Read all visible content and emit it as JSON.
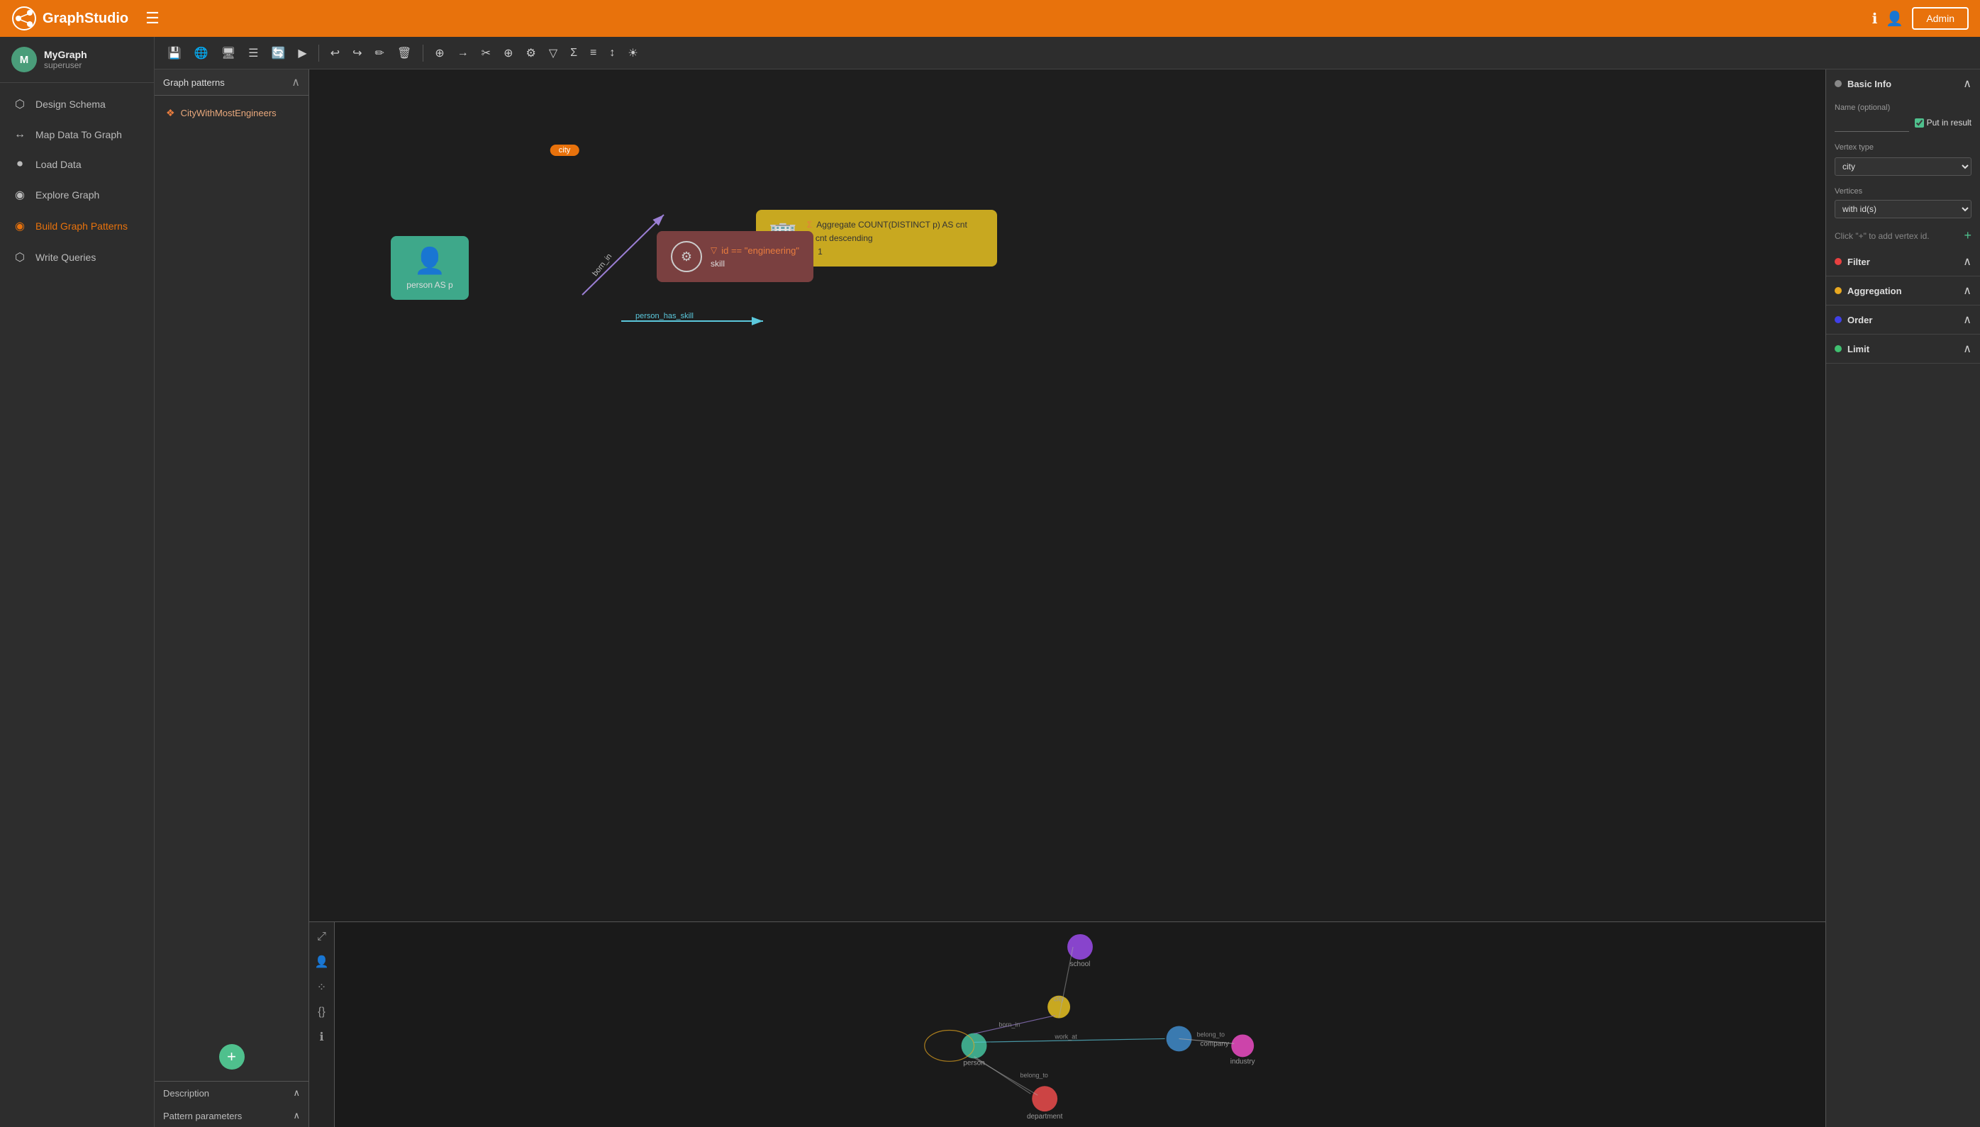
{
  "app": {
    "name": "GraphStudio",
    "hamburger": "☰"
  },
  "nav": {
    "admin_btn": "Admin",
    "info_icon": "ℹ",
    "user_icon": "👤"
  },
  "sidebar": {
    "user": {
      "initial": "M",
      "name": "MyGraph",
      "role": "superuser"
    },
    "items": [
      {
        "id": "design-schema",
        "label": "Design Schema",
        "icon": "⬡"
      },
      {
        "id": "map-data",
        "label": "Map Data To Graph",
        "icon": "↔"
      },
      {
        "id": "load-data",
        "label": "Load Data",
        "icon": "⏺"
      },
      {
        "id": "explore-graph",
        "label": "Explore Graph",
        "icon": "◉"
      },
      {
        "id": "build-patterns",
        "label": "Build Graph Patterns",
        "icon": "◉",
        "active": true
      },
      {
        "id": "write-queries",
        "label": "Write Queries",
        "icon": "⬡"
      }
    ]
  },
  "toolbar": {
    "buttons": [
      "💾",
      "🌐",
      "🖥",
      "☰",
      "🔄",
      "▶",
      "↩",
      "↪",
      "✏",
      "🗑",
      "⊕",
      "→",
      "✂",
      "⊕",
      "⚙",
      "▽",
      "Σ",
      "≡",
      "↕",
      "☀"
    ],
    "label": "Toolbar"
  },
  "pattern_panel": {
    "title": "Graph patterns",
    "item": "CityWithMostEngineers",
    "description_label": "Description",
    "parameters_label": "Pattern parameters"
  },
  "working_panel": {
    "label": "Working Panel",
    "city_node": {
      "label": "city",
      "lines": [
        "Aggregate COUNT(DISTINCT p) AS cnt",
        "cnt descending",
        "1"
      ]
    },
    "person_node": {
      "label": "person AS p"
    },
    "skill_node": {
      "label": "skill",
      "filter": "id == \"engineering\""
    },
    "edge_born_in": "born_in",
    "edge_person_skill": "person_has_skill"
  },
  "config_panel": {
    "title": "Basic Info",
    "label_title": "Config Panel",
    "name_label": "Name (optional)",
    "name_placeholder": "",
    "put_in_result": "Put in result",
    "vertex_type_label": "Vertex type",
    "vertex_type_value": "city",
    "vertices_label": "Vertices",
    "vertices_option": "with id(s)",
    "click_add_label": "Click \"+\" to add vertex id.",
    "sections": [
      {
        "id": "filter",
        "label": "Filter",
        "color": "#e84040"
      },
      {
        "id": "aggregation",
        "label": "Aggregation",
        "color": "#e8a820"
      },
      {
        "id": "order",
        "label": "Order",
        "color": "#4040e8"
      },
      {
        "id": "limit",
        "label": "Limit",
        "color": "#40c070"
      }
    ]
  },
  "console": {
    "label": "Console",
    "tools": [
      "⤢",
      "👤",
      "⁘",
      "{}",
      "ℹ"
    ]
  }
}
